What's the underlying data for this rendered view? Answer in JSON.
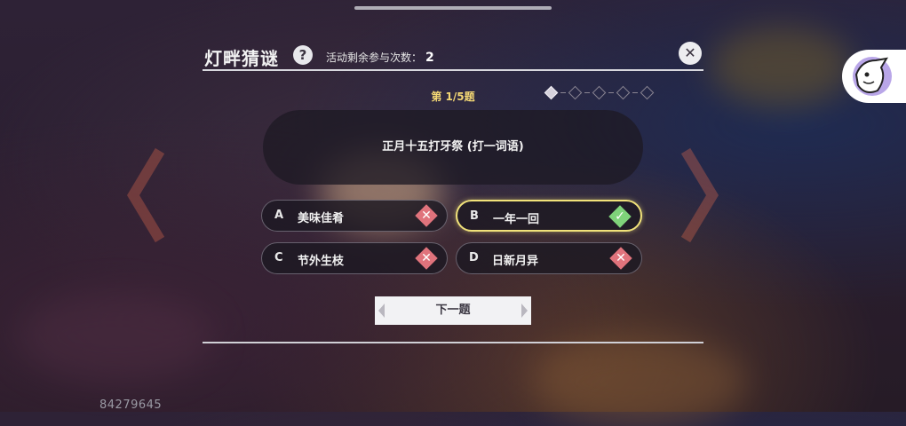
{
  "header": {
    "title": "灯畔猜谜",
    "help_icon": "?",
    "attempts_label": "活动剩余参与次数：",
    "attempts_value": "2"
  },
  "quiz": {
    "question_number": "第 1/5题",
    "question_text": "正月十五打牙祭 (打一词语)",
    "progress_total": 5,
    "progress_current": 1
  },
  "options": [
    {
      "letter": "A",
      "text": "美味佳肴",
      "state": "wrong"
    },
    {
      "letter": "B",
      "text": "一年一回",
      "state": "correct"
    },
    {
      "letter": "C",
      "text": "节外生枝",
      "state": "wrong"
    },
    {
      "letter": "D",
      "text": "日新月异",
      "state": "wrong"
    }
  ],
  "next_button_label": "下一题",
  "uid": "84279645",
  "colors": {
    "accent_yellow": "#f1e27a",
    "wrong_mark": "#e0737c",
    "correct_mark": "#7fd37a"
  }
}
